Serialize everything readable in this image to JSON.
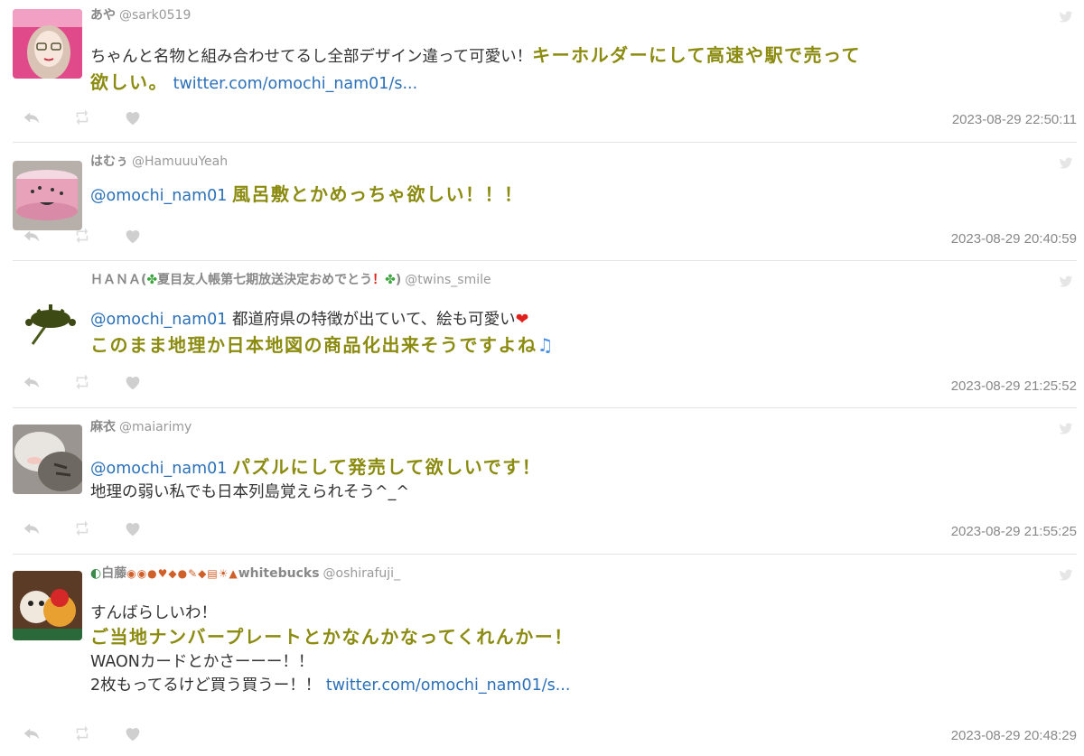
{
  "tweets": [
    {
      "name": "あや",
      "handle": "@sark0519",
      "line1_text": "ちゃんと名物と組み合わせてるし全部デザイン違って可愛い！",
      "line1_hl": "キーホルダーにして高速や駅で売って",
      "line2_hl": "欲しい。",
      "link": "twitter.com/omochi_nam01/s...",
      "time": "2023-08-29 22:50:11"
    },
    {
      "name": "はむぅ",
      "handle": "@HamuuuYeah",
      "mention": "@omochi_nam01",
      "hl": "風呂敷とかめっちゃ欲しい！！！",
      "time": "2023-08-29 20:40:59"
    },
    {
      "name_a": "ＨＡＮＡ(",
      "name_clover": "✤",
      "name_b": "夏目友人帳第七期放送決定おめでとう",
      "name_excl": "！",
      "name_c": ")",
      "handle": "@twins_smile",
      "mention": "@omochi_nam01",
      "text": "都道府県の特徴が出ていて、絵も可愛い",
      "heart": "❤",
      "hl": "このまま地理か日本地図の商品化出来そうですよね",
      "note": "♫",
      "time": "2023-08-29 21:25:52"
    },
    {
      "name": "麻衣",
      "handle": "@maiarimy",
      "mention": "@omochi_nam01",
      "hl": "パズルにして発売して欲しいです！",
      "text": "地理の弱い私でも日本列島覚えられそう^_^",
      "time": "2023-08-29 21:55:25"
    },
    {
      "name_pre": "白藤",
      "name_emoji": "◉◉●♥◆●✎◆▤☀▲",
      "name_post": "whitebucks",
      "handle": "@oshirafuji_",
      "line1": "すんばらしいわ！",
      "hl": "ご当地ナンバープレートとかなんかなってくれんかー！",
      "line3": "WAONカードとかさーーー！！",
      "line4": "2枚もってるけど買う買うー！！",
      "link": "twitter.com/omochi_nam01/s...",
      "time": "2023-08-29 20:48:29"
    }
  ],
  "icons": {
    "reply": "reply-icon",
    "retweet": "retweet-icon",
    "like": "heart-icon",
    "bird": "twitter-bird-icon"
  },
  "colors": {
    "highlight": "#8b8b10",
    "link": "#2b70b8",
    "timestamp": "#888888",
    "icon": "#cfcfcf"
  }
}
